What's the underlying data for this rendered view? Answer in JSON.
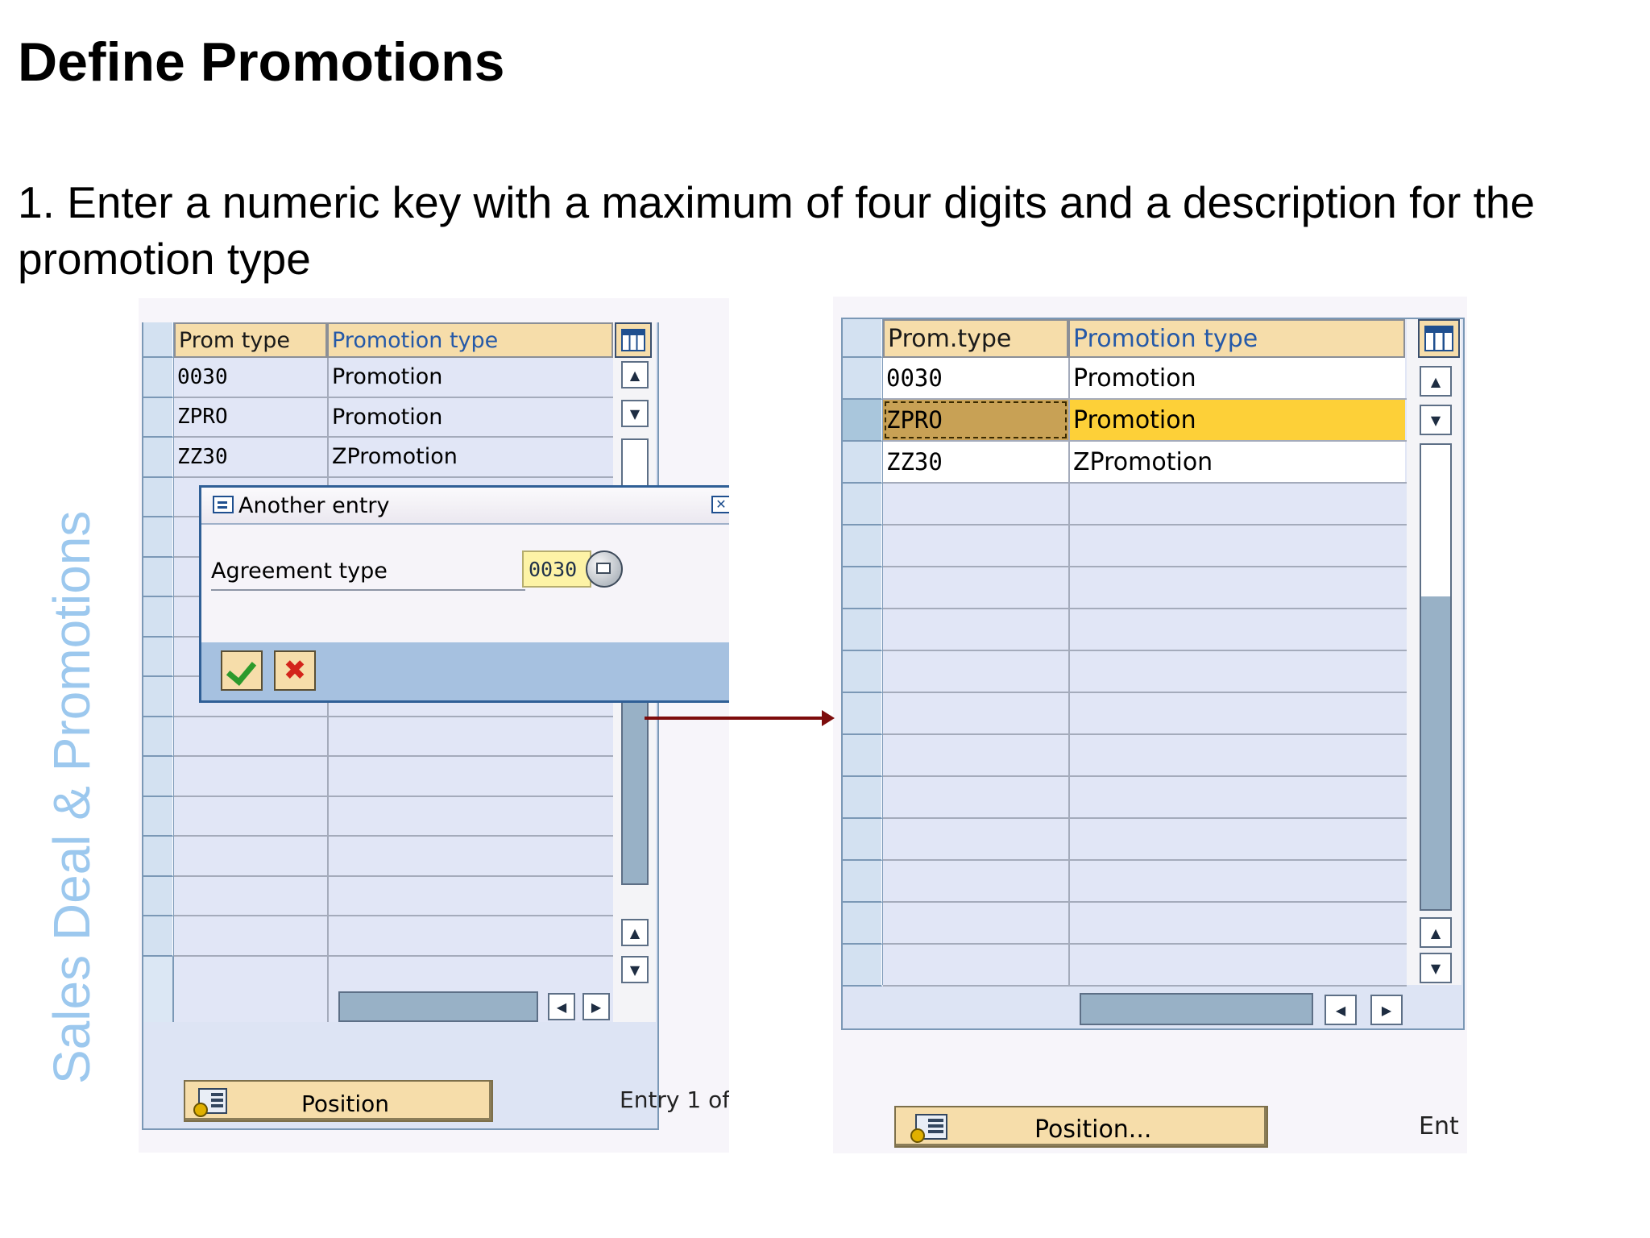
{
  "slide": {
    "title": "Define Promotions",
    "instruction": "1. Enter a numeric key with a maximum of four digits and a description for the promotion type",
    "side_label": "Sales Deal & Promotions"
  },
  "left_screen": {
    "columns": [
      "Prom type",
      "Promotion type"
    ],
    "rows": [
      {
        "key": "0030",
        "description": "Promotion"
      },
      {
        "key": "ZPRO",
        "description": "Promotion"
      },
      {
        "key": "ZZ30",
        "description": "ZPromotion"
      }
    ],
    "empty_row_count": 12,
    "position_button": "Position",
    "entry_text": "Entry 1 of",
    "dialog": {
      "title": "Another entry",
      "field_label": "Agreement type",
      "field_value": "0030",
      "confirm_icon": "checkmark-icon",
      "cancel_icon": "cancel-icon",
      "close_icon": "close-icon"
    }
  },
  "right_screen": {
    "columns": [
      "Prom.type",
      "Promotion type"
    ],
    "rows": [
      {
        "key": "0030",
        "description": "Promotion"
      },
      {
        "key": "ZPRO",
        "description": "Promotion",
        "selected": true
      },
      {
        "key": "ZZ30",
        "description": "ZPromotion"
      }
    ],
    "empty_row_count": 12,
    "position_button": "Position...",
    "entry_text": "Ent"
  },
  "colors": {
    "header_bg": "#f6ddaa",
    "grid_bg": "#e1e6f6",
    "selected_key_bg": "#c8a155",
    "selected_desc_bg": "#fdd038",
    "side_label": "#9cc8ee",
    "arrow": "#7d0c0c"
  }
}
